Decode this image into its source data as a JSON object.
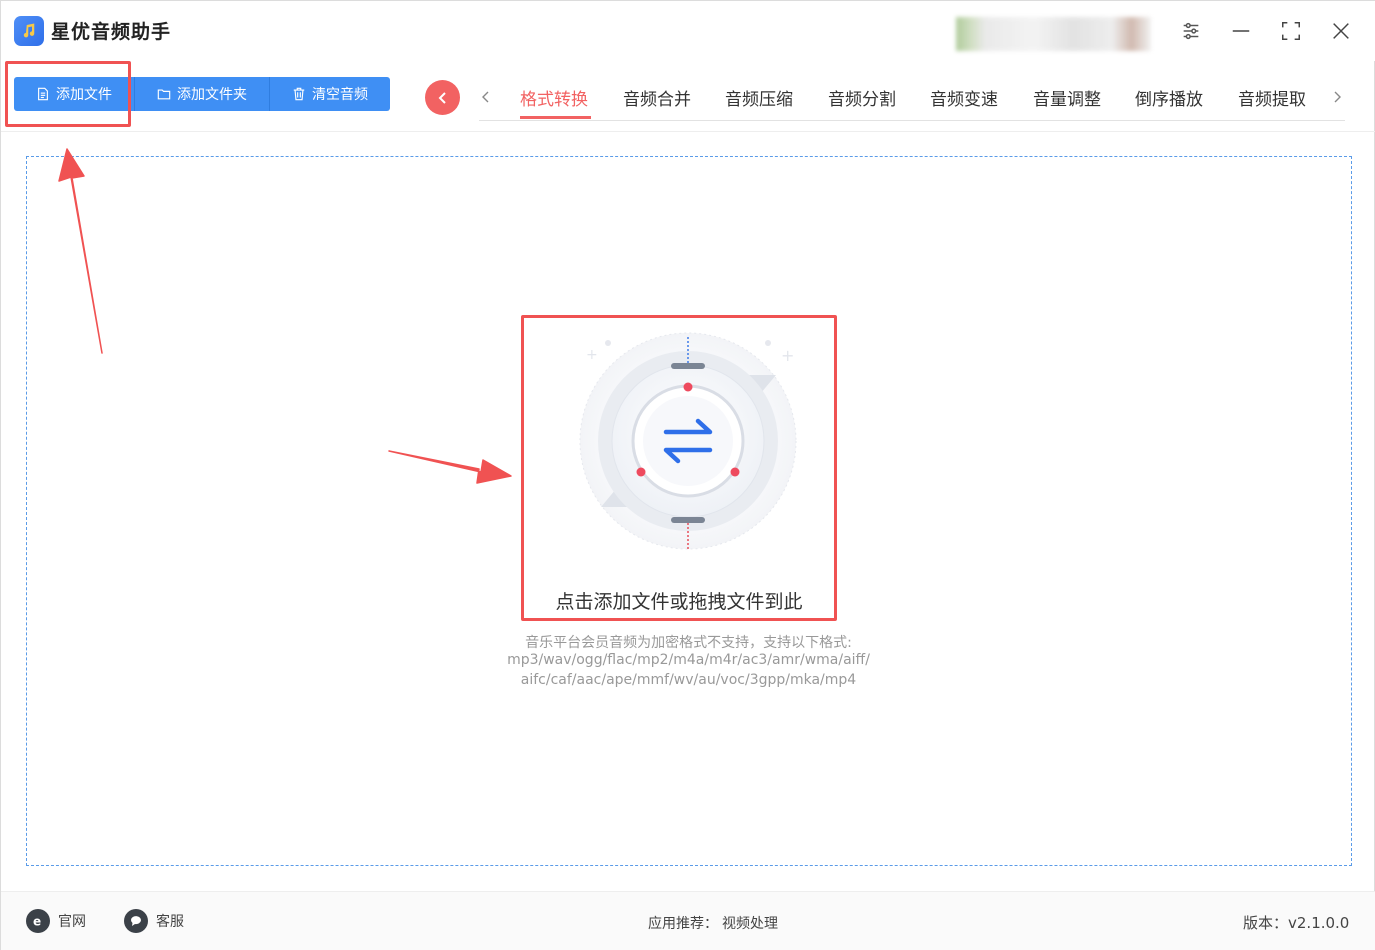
{
  "app": {
    "title": "星优音频助手"
  },
  "toolbar": {
    "add_file": "添加文件",
    "add_folder": "添加文件夹",
    "clear_audio": "清空音频"
  },
  "tabs": [
    {
      "label": "格式转换",
      "active": true
    },
    {
      "label": "音频合并"
    },
    {
      "label": "音频压缩"
    },
    {
      "label": "音频分割"
    },
    {
      "label": "音频变速"
    },
    {
      "label": "音量调整"
    },
    {
      "label": "倒序播放"
    },
    {
      "label": "音频提取"
    }
  ],
  "dropzone": {
    "prompt": "点击添加文件或拖拽文件到此",
    "hint_line1": "音乐平台会员音频为加密格式不支持，支持以下格式:",
    "hint_line2": "mp3/wav/ogg/flac/mp2/m4a/m4r/ac3/amr/wma/aiff/",
    "hint_line3": "aifc/caf/aac/ape/mmf/wv/au/voc/3gpp/mka/mp4"
  },
  "footer": {
    "website": "官网",
    "support": "客服",
    "recommend_label": "应用推荐：",
    "recommend_link": "视频处理",
    "version": "版本：v2.1.0.0"
  },
  "colors": {
    "primary": "#3f8ff4",
    "accent": "#f26262",
    "dashed_border": "#5a9be8"
  }
}
